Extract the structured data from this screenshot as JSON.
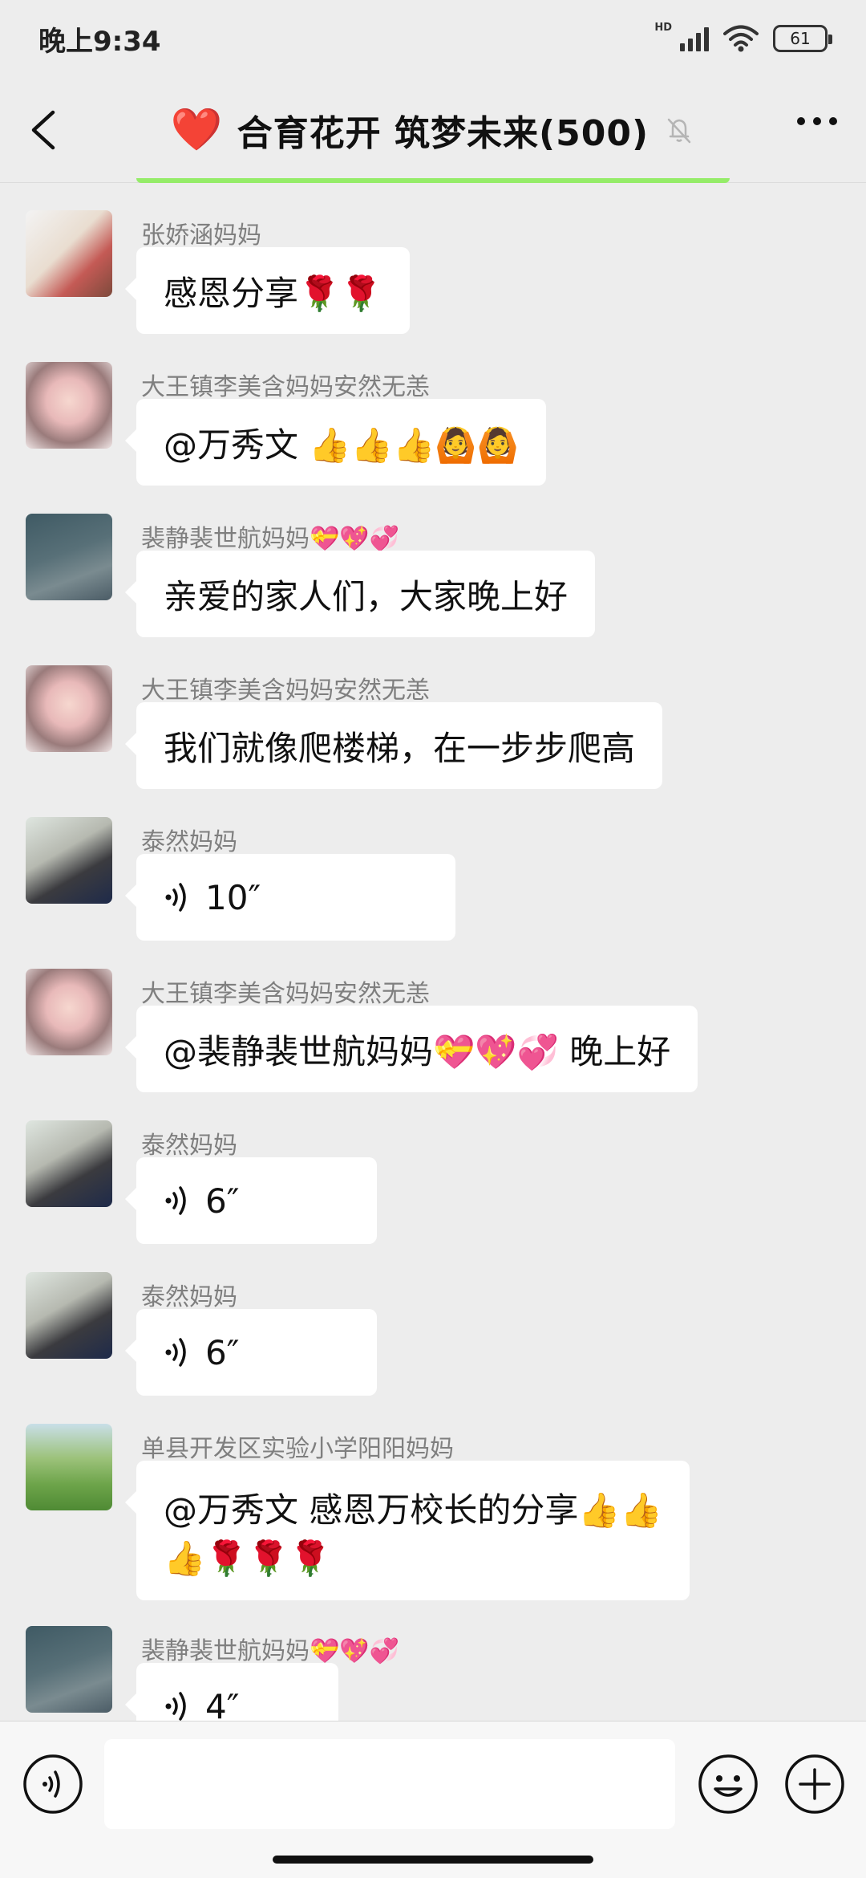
{
  "status": {
    "time": "晚上9:34",
    "network_badge": "HD",
    "battery": "61"
  },
  "chat": {
    "title": "合育花开 筑梦未来(500)",
    "title_emoji": "❤️"
  },
  "messages": [
    {
      "sender": "张娇涵妈妈",
      "type": "text",
      "text": "感恩分享🌹🌹"
    },
    {
      "sender": "大王镇李美含妈妈安然无恙",
      "type": "text",
      "text": "@万秀文  👍👍👍🙆🙆"
    },
    {
      "sender": "裴静裴世航妈妈💝💖💞",
      "type": "text",
      "text": "亲爱的家人们，大家晚上好"
    },
    {
      "sender": "大王镇李美含妈妈安然无恙",
      "type": "text",
      "text": "我们就像爬楼梯，在一步步爬高"
    },
    {
      "sender": "泰然妈妈",
      "type": "voice",
      "text": "10″"
    },
    {
      "sender": "大王镇李美含妈妈安然无恙",
      "type": "text",
      "text": "@裴静裴世航妈妈💝💖💞  晚上好"
    },
    {
      "sender": "泰然妈妈",
      "type": "voice",
      "text": "6″"
    },
    {
      "sender": "泰然妈妈",
      "type": "voice",
      "text": "6″"
    },
    {
      "sender": "单县开发区实验小学阳阳妈妈",
      "type": "text",
      "text_line1": "@万秀文  感恩万校长的分享👍👍",
      "text_line2": "👍🌹🌹🌹"
    },
    {
      "sender": "裴静裴世航妈妈💝💖💞",
      "type": "voice",
      "text": "4″"
    }
  ],
  "input": {
    "placeholder": ""
  },
  "icons": {
    "back": "chevron-left-icon",
    "mute": "muted-bell-icon",
    "more": "more-dots-icon",
    "voice_input": "voice-input-icon",
    "emoji": "emoji-icon",
    "add": "plus-icon"
  },
  "colors": {
    "background": "#ededed",
    "bubble": "#ffffff",
    "accent_green": "#95ec69",
    "heart": "#e0201b"
  }
}
